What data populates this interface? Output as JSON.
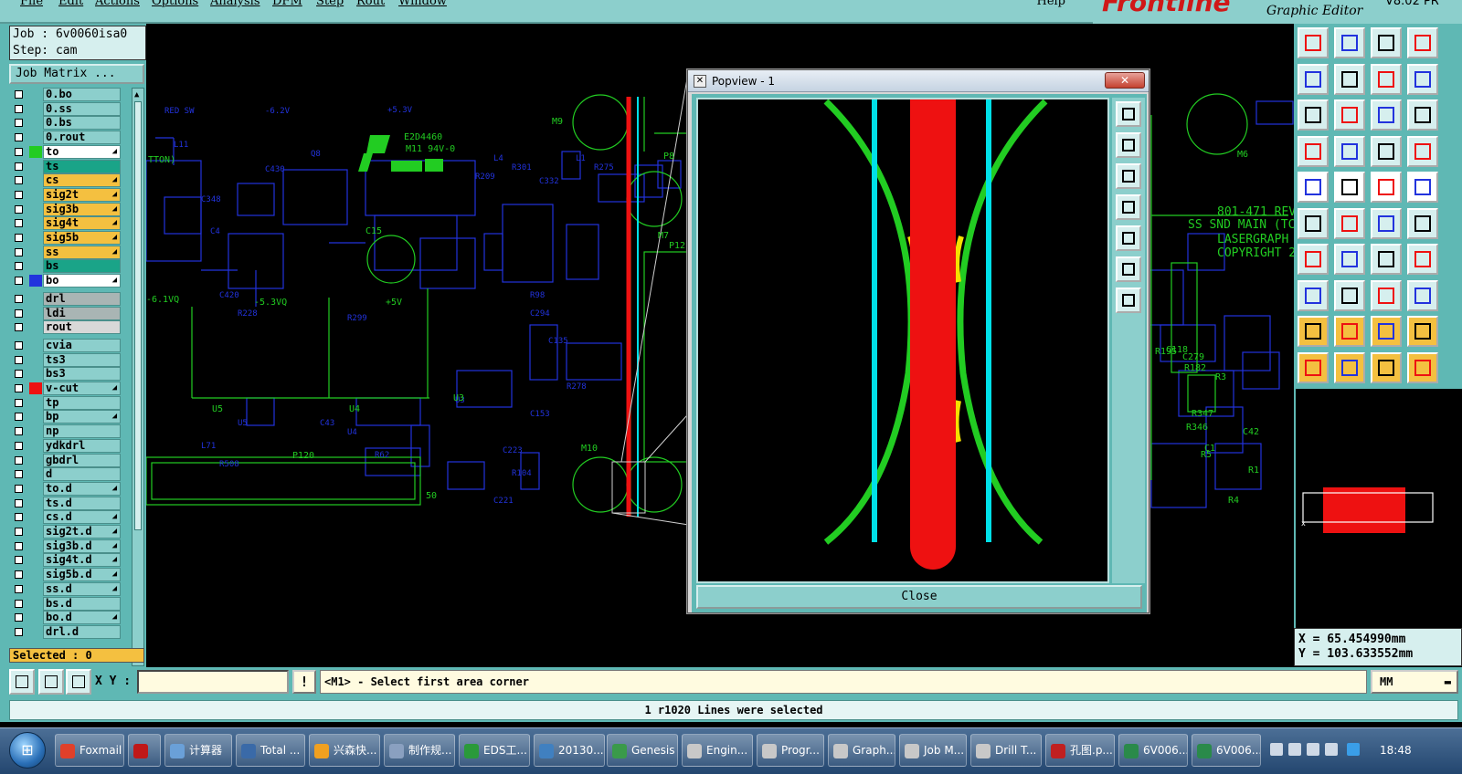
{
  "menu": {
    "items": [
      "File",
      "Edit",
      "Actions",
      "Options",
      "Analysis",
      "DFM",
      "Step",
      "Rout",
      "Window"
    ],
    "help": "Help"
  },
  "brand": {
    "logo": "Frontline",
    "subtitle": "Graphic Editor",
    "version": "V8.02 PR"
  },
  "left": {
    "job": "Job : 6v0060isa0",
    "step": "Step: cam",
    "job_matrix": "Job Matrix ...",
    "selected": "Selected : 0",
    "layers": [
      {
        "name": "0.bo",
        "bg": "#8ccfcc",
        "swatch": ""
      },
      {
        "name": "0.ss",
        "bg": "#8ccfcc",
        "swatch": ""
      },
      {
        "name": "0.bs",
        "bg": "#8ccfcc",
        "swatch": ""
      },
      {
        "name": "0.rout",
        "bg": "#8ccfcc",
        "swatch": ""
      },
      {
        "name": "to",
        "bg": "#ffffff",
        "swatch": "#22cc22",
        "edit": true
      },
      {
        "name": "ts",
        "bg": "#1aa488",
        "swatch": ""
      },
      {
        "name": "cs",
        "bg": "#f4c040",
        "swatch": "",
        "edit": true
      },
      {
        "name": "sig2t",
        "bg": "#f4c040",
        "swatch": "",
        "edit": true
      },
      {
        "name": "sig3b",
        "bg": "#f4c040",
        "swatch": "",
        "edit": true
      },
      {
        "name": "sig4t",
        "bg": "#f4c040",
        "swatch": "",
        "edit": true
      },
      {
        "name": "sig5b",
        "bg": "#f4c040",
        "swatch": "",
        "edit": true
      },
      {
        "name": "ss",
        "bg": "#f4c040",
        "swatch": "",
        "edit": true
      },
      {
        "name": "bs",
        "bg": "#1aa488",
        "swatch": ""
      },
      {
        "name": "bo",
        "bg": "#ffffff",
        "swatch": "#2233dd",
        "edit": true
      },
      {
        "name": "drl",
        "bg": "#a9b5b4",
        "swatch": ""
      },
      {
        "name": "ldi",
        "bg": "#a9b5b4",
        "swatch": ""
      },
      {
        "name": "rout",
        "bg": "#d8d8d8",
        "swatch": ""
      },
      {
        "name": "cvia",
        "bg": "#8ccfcc",
        "swatch": ""
      },
      {
        "name": "ts3",
        "bg": "#8ccfcc",
        "swatch": ""
      },
      {
        "name": "bs3",
        "bg": "#8ccfcc",
        "swatch": ""
      },
      {
        "name": "v-cut",
        "bg": "#8ccfcc",
        "swatch": "#ee1111",
        "edit": true
      },
      {
        "name": "tp",
        "bg": "#8ccfcc",
        "swatch": ""
      },
      {
        "name": "bp",
        "bg": "#8ccfcc",
        "swatch": "",
        "edit": true
      },
      {
        "name": "np",
        "bg": "#8ccfcc",
        "swatch": ""
      },
      {
        "name": "ydkdrl",
        "bg": "#8ccfcc",
        "swatch": ""
      },
      {
        "name": "gbdrl",
        "bg": "#8ccfcc",
        "swatch": ""
      },
      {
        "name": "d",
        "bg": "#8ccfcc",
        "swatch": ""
      },
      {
        "name": "to.d",
        "bg": "#8ccfcc",
        "swatch": "",
        "edit": true
      },
      {
        "name": "ts.d",
        "bg": "#8ccfcc",
        "swatch": ""
      },
      {
        "name": "cs.d",
        "bg": "#8ccfcc",
        "swatch": "",
        "edit": true
      },
      {
        "name": "sig2t.d",
        "bg": "#8ccfcc",
        "swatch": "",
        "edit": true
      },
      {
        "name": "sig3b.d",
        "bg": "#8ccfcc",
        "swatch": "",
        "edit": true
      },
      {
        "name": "sig4t.d",
        "bg": "#8ccfcc",
        "swatch": "",
        "edit": true
      },
      {
        "name": "sig5b.d",
        "bg": "#8ccfcc",
        "swatch": "",
        "edit": true
      },
      {
        "name": "ss.d",
        "bg": "#8ccfcc",
        "swatch": "",
        "edit": true
      },
      {
        "name": "bs.d",
        "bg": "#8ccfcc",
        "swatch": ""
      },
      {
        "name": "bo.d",
        "bg": "#8ccfcc",
        "swatch": "",
        "edit": true
      },
      {
        "name": "drl.d",
        "bg": "#8ccfcc",
        "swatch": ""
      }
    ]
  },
  "canvas": {
    "labels": [
      "TTON)",
      "-6.1VQ",
      "-5.3VQ",
      "+5V",
      "C15",
      "E2D4460",
      "M11 94V-0",
      "P120",
      "50",
      "P8",
      "P12",
      "M7",
      "M9",
      "M10",
      "U3",
      "U4",
      "U5",
      "801-471 REV",
      "SS SND MAIN (TC",
      "LASERGRAPH",
      "COPYRIGHT 2",
      "M6",
      "C279",
      "R182",
      "C118",
      "R195",
      "R347",
      "R346",
      "C42",
      "R3",
      "R5",
      "C1",
      "R1",
      "R4"
    ]
  },
  "popview": {
    "title": "Popview - 1",
    "close_x": "✕",
    "close_button": "Close"
  },
  "coords": {
    "x": "X =  65.454990mm",
    "y": "Y = 103.633552mm"
  },
  "bottom": {
    "xy_label": "X Y :",
    "xy_value": "",
    "excl": "!",
    "prompt": "<M1> - Select first area corner",
    "units": "MM",
    "status": "1 r1020 Lines were selected"
  },
  "taskbar": {
    "tasks": [
      "Foxmail",
      "",
      "计算器",
      "Total ...",
      "兴森快...",
      "制作规...",
      "EDS工...",
      "20130...",
      "Genesis",
      "Engin...",
      "Progr...",
      "Graph...",
      "Job M...",
      "Drill T...",
      "孔图.p...",
      "6V006...",
      "6V006..."
    ],
    "clock": "18:48"
  },
  "colors": {
    "panel": "#5fb8b4",
    "button": "#8ccfcc",
    "light": "#d6efee",
    "red": "#ee1111",
    "cyan": "#00e0e8",
    "green": "#22cc22"
  }
}
